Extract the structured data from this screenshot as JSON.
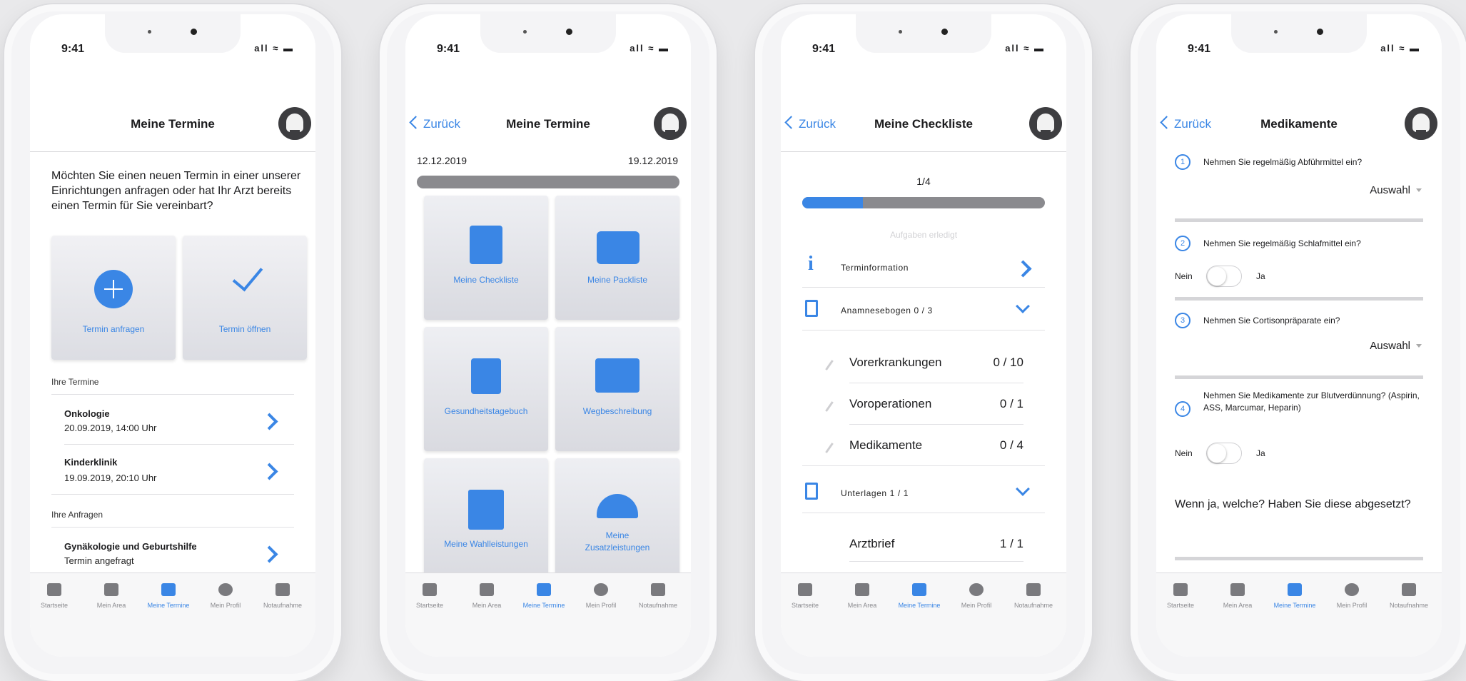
{
  "status": {
    "time": "9:41",
    "icons": "all ≈ ▬"
  },
  "tabs": [
    {
      "label": "Startseite",
      "icon": "home-icon"
    },
    {
      "label": "Mein Area",
      "icon": "area-icon"
    },
    {
      "label": "Meine Termine",
      "icon": "bed-icon"
    },
    {
      "label": "Mein Profil",
      "icon": "profile-icon"
    },
    {
      "label": "Notaufnahme",
      "icon": "ambulance-icon"
    }
  ],
  "accent": "#3a86e5",
  "screen1": {
    "title": "Meine Termine",
    "intro": "Möchten Sie einen neuen Termin in einer unserer Einrichtungen anfragen oder hat Ihr Arzt bereits einen Termin für Sie vereinbart?",
    "card_request": "Termin anfragen",
    "card_open": "Termin öffnen",
    "section_appointments": "Ihre Termine",
    "appointments": [
      {
        "title": "Onkologie",
        "sub": "20.09.2019, 14:00 Uhr"
      },
      {
        "title": "Kinderklinik",
        "sub": "19.09.2019, 20:10 Uhr"
      }
    ],
    "section_requests": "Ihre Anfragen",
    "requests": [
      {
        "title": "Gynäkologie und Geburtshilfe",
        "sub": "Termin angefragt"
      }
    ]
  },
  "screen2": {
    "back": "Zurück",
    "title": "Meine Termine",
    "date_start": "12.12.2019",
    "date_end": "19.12.2019",
    "tiles": [
      {
        "label": "Meine Checkliste",
        "icon": "checklist-icon"
      },
      {
        "label": "Meine Packliste",
        "icon": "suitcase-icon"
      },
      {
        "label": "Gesundheitstagebuch",
        "icon": "diary-icon"
      },
      {
        "label": "Wegbeschreibung",
        "icon": "map-pin-icon"
      },
      {
        "label": "Meine Wahlleistungen",
        "icon": "hospital-icon"
      },
      {
        "label": "Meine Zusatzleistungen",
        "icon": "service-bell-icon"
      }
    ]
  },
  "screen3": {
    "back": "Zurück",
    "title": "Meine Checkliste",
    "progress_text": "1/4",
    "progress": 0.25,
    "faint_text": "Aufgaben erledigt",
    "rows": [
      {
        "label": "Terminformation",
        "icon": "info-icon"
      },
      {
        "label": "Anamnesebogen 0 / 3",
        "icon": "clipboard-icon"
      }
    ],
    "sub_rows": [
      {
        "label": "Vorerkrankungen",
        "value": "0 / 10"
      },
      {
        "label": "Voroperationen",
        "value": "0 / 1"
      },
      {
        "label": "Medikamente",
        "value": "0 / 4"
      }
    ],
    "docs_row": "Unterlagen 1 / 1",
    "doc_items": [
      {
        "label": "Arztbrief",
        "value": "1 / 1"
      }
    ]
  },
  "screen4": {
    "back": "Zurück",
    "title": "Medikamente",
    "q1": "Nehmen Sie regelmäßig Abführmittel ein?",
    "q2": "Nehmen Sie regelmäßig Schlafmittel ein?",
    "q3": "Nehmen Sie Cortisonpräparate ein?",
    "q4": "Nehmen Sie Medikamente zur Blutverdünnung? (Aspirin, ASS, Marcumar, Heparin)",
    "select_label": "Auswahl",
    "no": "Nein",
    "yes": "Ja",
    "followup": "Wenn ja, welche? Haben Sie diese abgesetzt?",
    "num1": "1",
    "num2": "2",
    "num3": "3",
    "num4": "4"
  }
}
